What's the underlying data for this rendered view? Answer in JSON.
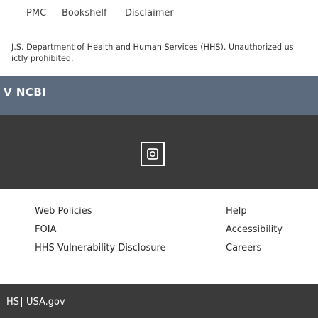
{
  "topnav": {
    "links": [
      "PMC",
      "Bookshelf",
      "Disclaimer"
    ]
  },
  "notice": {
    "line1": "J.S. Department of Health and Human Services (HHS). Unauthorized us",
    "line2": "ictly prohibited."
  },
  "ncbi_band": {
    "text": "V NCBI"
  },
  "social": {
    "icon": "social-square-icon"
  },
  "footer": {
    "col1": [
      "Web Policies",
      "FOIA",
      "HHS Vulnerability Disclosure"
    ],
    "col2": [
      "Help",
      "Accessibility",
      "Careers"
    ]
  },
  "bottom": {
    "hhs": "HS",
    "usagov": "USA.gov"
  },
  "colors": {
    "ncbi_band": "#5d6b7e",
    "dark_band": "#3a3a3a"
  }
}
